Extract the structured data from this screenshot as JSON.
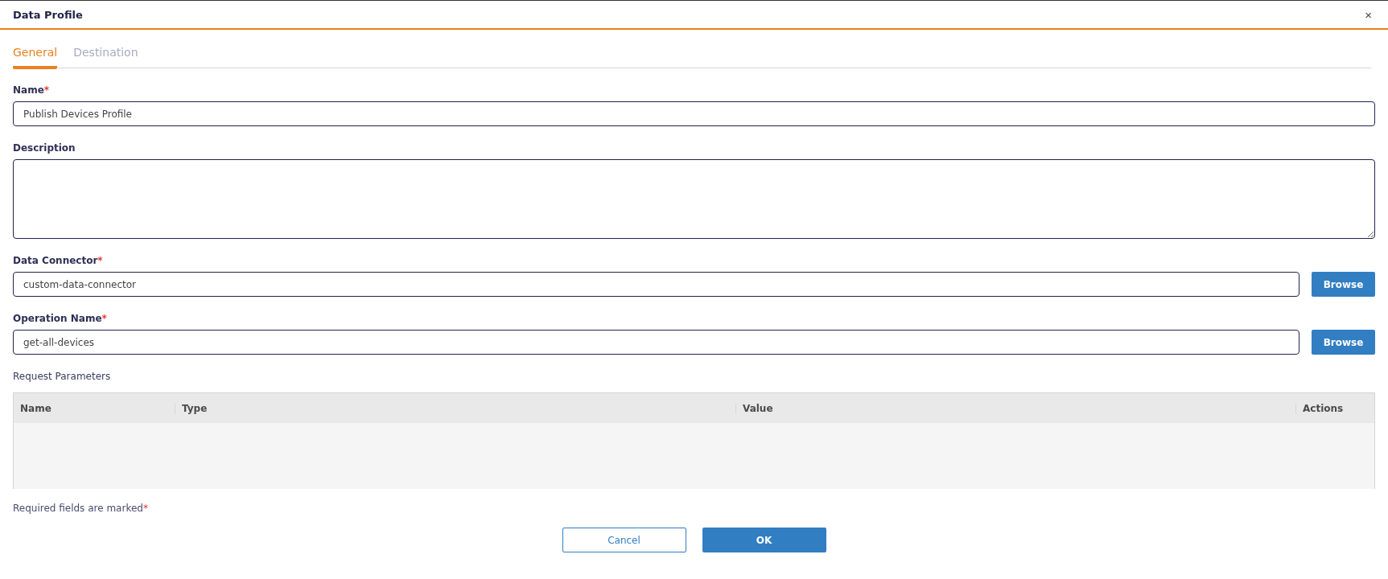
{
  "window": {
    "title": "Data Profile",
    "close": "×"
  },
  "tabs": [
    {
      "label": "General",
      "selected": true
    },
    {
      "label": "Destination",
      "selected": false
    }
  ],
  "fields": [
    {
      "kind": "input",
      "label": "Name",
      "mark": "*",
      "value": "Publish Devices Profile"
    },
    {
      "kind": "textarea",
      "label": "Description"
    },
    {
      "kind": "browse",
      "label": "Data Connector",
      "mark": "*",
      "value": "custom-data-connector",
      "button": "Browse"
    },
    {
      "kind": "browse",
      "label": "Operation Name",
      "mark": "*",
      "value": "get-all-devices",
      "button": "Browse"
    }
  ],
  "request_parameters": {
    "title": "Request Parameters",
    "columns": [
      "Name",
      "Type",
      "Value",
      "Actions"
    ]
  },
  "footer_note": {
    "text": "Required fields are marked",
    "mark": "*"
  },
  "buttons": [
    {
      "label": "Cancel",
      "kind": "secondary"
    },
    {
      "label": "OK",
      "kind": "primary"
    }
  ]
}
